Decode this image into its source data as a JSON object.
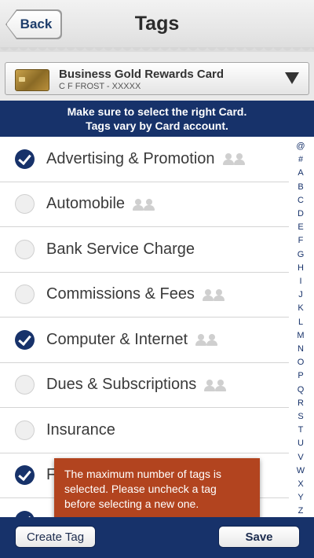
{
  "header": {
    "back_label": "Back",
    "title": "Tags"
  },
  "card": {
    "name": "Business Gold Rewards Card",
    "holder": "C F FROST - XXXXX"
  },
  "notice": {
    "line1": "Make sure to select the right Card.",
    "line2": "Tags vary by Card  account."
  },
  "tags": [
    {
      "label": "Advertising & Promotion",
      "checked": true,
      "shared": true
    },
    {
      "label": "Automobile",
      "checked": false,
      "shared": true
    },
    {
      "label": "Bank Service Charge",
      "checked": false,
      "shared": false
    },
    {
      "label": "Commissions & Fees",
      "checked": false,
      "shared": true
    },
    {
      "label": "Computer & Internet",
      "checked": true,
      "shared": true
    },
    {
      "label": "Dues & Subscriptions",
      "checked": false,
      "shared": true
    },
    {
      "label": "Insurance",
      "checked": false,
      "shared": false
    },
    {
      "label": "F",
      "checked": true,
      "shared": false
    },
    {
      "label": "",
      "checked": true,
      "shared": false
    }
  ],
  "alphabet": [
    "@",
    "#",
    "A",
    "B",
    "C",
    "D",
    "E",
    "F",
    "G",
    "H",
    "I",
    "J",
    "K",
    "L",
    "M",
    "N",
    "O",
    "P",
    "Q",
    "R",
    "S",
    "T",
    "U",
    "V",
    "W",
    "X",
    "Y",
    "Z"
  ],
  "toast": {
    "message": "The maximum number of tags is selected. Please uncheck a tag before selecting a new one."
  },
  "footer": {
    "create_label": "Create Tag",
    "save_label": "Save"
  },
  "colors": {
    "navy": "#17326a",
    "toast": "#b2441f"
  }
}
